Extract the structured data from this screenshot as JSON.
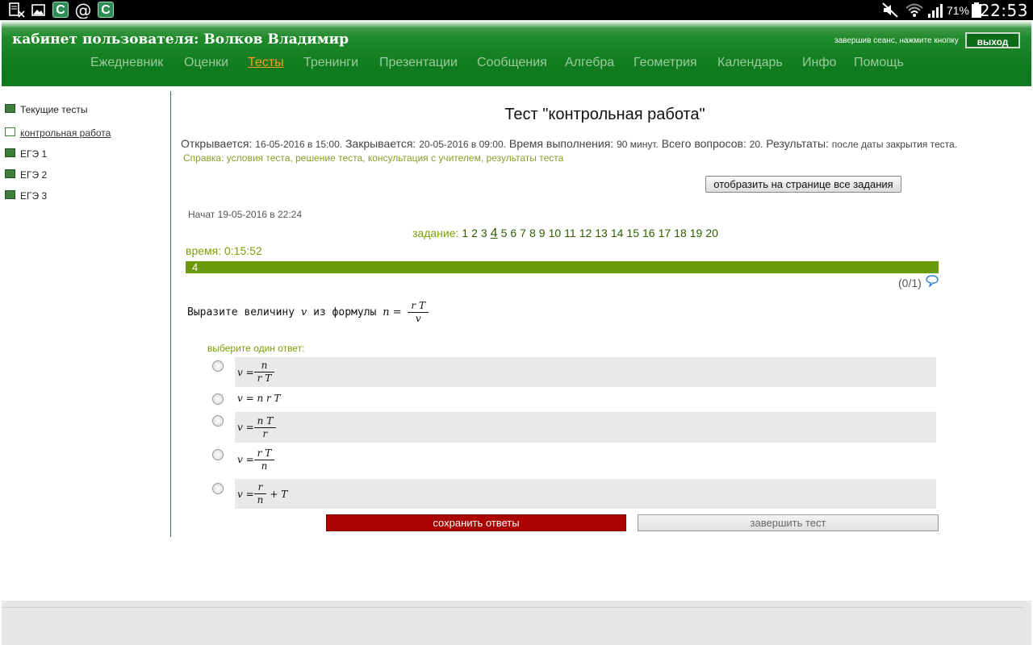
{
  "statusbar": {
    "battery": "71%",
    "time": "22:53",
    "left_icons": [
      "file-x-icon",
      "image-icon",
      "app-c-icon",
      "at-icon",
      "app-c-icon"
    ],
    "right_icons": [
      "mute-icon",
      "wifi-icon",
      "signal-icon",
      "battery-icon"
    ]
  },
  "header": {
    "title": "кабинет пользователя: Волков Владимир",
    "logout_hint": "завершив сеанс, нажмите кнопку",
    "logout_label": "выход",
    "nav": [
      "Ежедневник",
      "Оценки",
      "Тесты",
      "Тренинги",
      "Презентации",
      "Сообщения",
      "Алгебра",
      "Геометрия",
      "Календарь",
      "Инфо",
      "Помощь"
    ],
    "active_nav": "Тесты"
  },
  "sidebar": {
    "items": [
      {
        "label": "Текущие тесты"
      },
      {
        "label": "контрольная работа"
      },
      {
        "label": "ЕГЭ 1"
      },
      {
        "label": "ЕГЭ 2"
      },
      {
        "label": "ЕГЭ 3"
      }
    ]
  },
  "test": {
    "title": "Тест \"контрольная работа\"",
    "opens_label": "Открывается:",
    "opens_value": "16-05-2016 в 15:00.",
    "closes_label": "Закрывается:",
    "closes_value": "20-05-2016 в 09:00.",
    "duration_label": "Время выполнения:",
    "duration_value": "90 минут.",
    "questions_label": "Всего вопросов:",
    "questions_value": "20.",
    "results_label": "Результаты:",
    "results_value": "после даты закрытия теста.",
    "help_label": "Справка:",
    "help_links": "условия теста, решение теста, консультация с учителем, результаты теста",
    "show_all_label": "отобразить на странице все задания",
    "started": "Начат 19-05-2016 в 22:24",
    "task_label": "задание:",
    "tasks": [
      "1",
      "2",
      "3",
      "4",
      "5",
      "6",
      "7",
      "8",
      "9",
      "10",
      "11",
      "12",
      "13",
      "14",
      "15",
      "16",
      "17",
      "18",
      "19",
      "20"
    ],
    "current_task": "4",
    "time_label": "время: 0:15:52",
    "progress_label": "4",
    "score": "(0/1)"
  },
  "question": {
    "text_prefix": "Выразите величину",
    "var_v": "v",
    "text_mid": "из формулы",
    "formula_lhs": "n =",
    "formula_num": "r T",
    "formula_den": "v",
    "choose_label": "выберите один ответ:",
    "answers": [
      {
        "lhs": "v =",
        "num": "n",
        "den": "r T",
        "tail": ""
      },
      {
        "lhs": "v = n r T",
        "num": "",
        "den": "",
        "tail": ""
      },
      {
        "lhs": "v =",
        "num": "n T",
        "den": "r",
        "tail": ""
      },
      {
        "lhs": "v =",
        "num": "r T",
        "den": "n",
        "tail": ""
      },
      {
        "lhs": "v =",
        "num": "r",
        "den": "n",
        "tail": "+ T"
      }
    ]
  },
  "buttons": {
    "save": "сохранить ответы",
    "finish": "завершить тест"
  },
  "colors": {
    "header_green": "#0f7a1e",
    "nav_active": "#ff9a1a",
    "progress_green": "#6a9a0a",
    "save_red": "#aa0000"
  }
}
